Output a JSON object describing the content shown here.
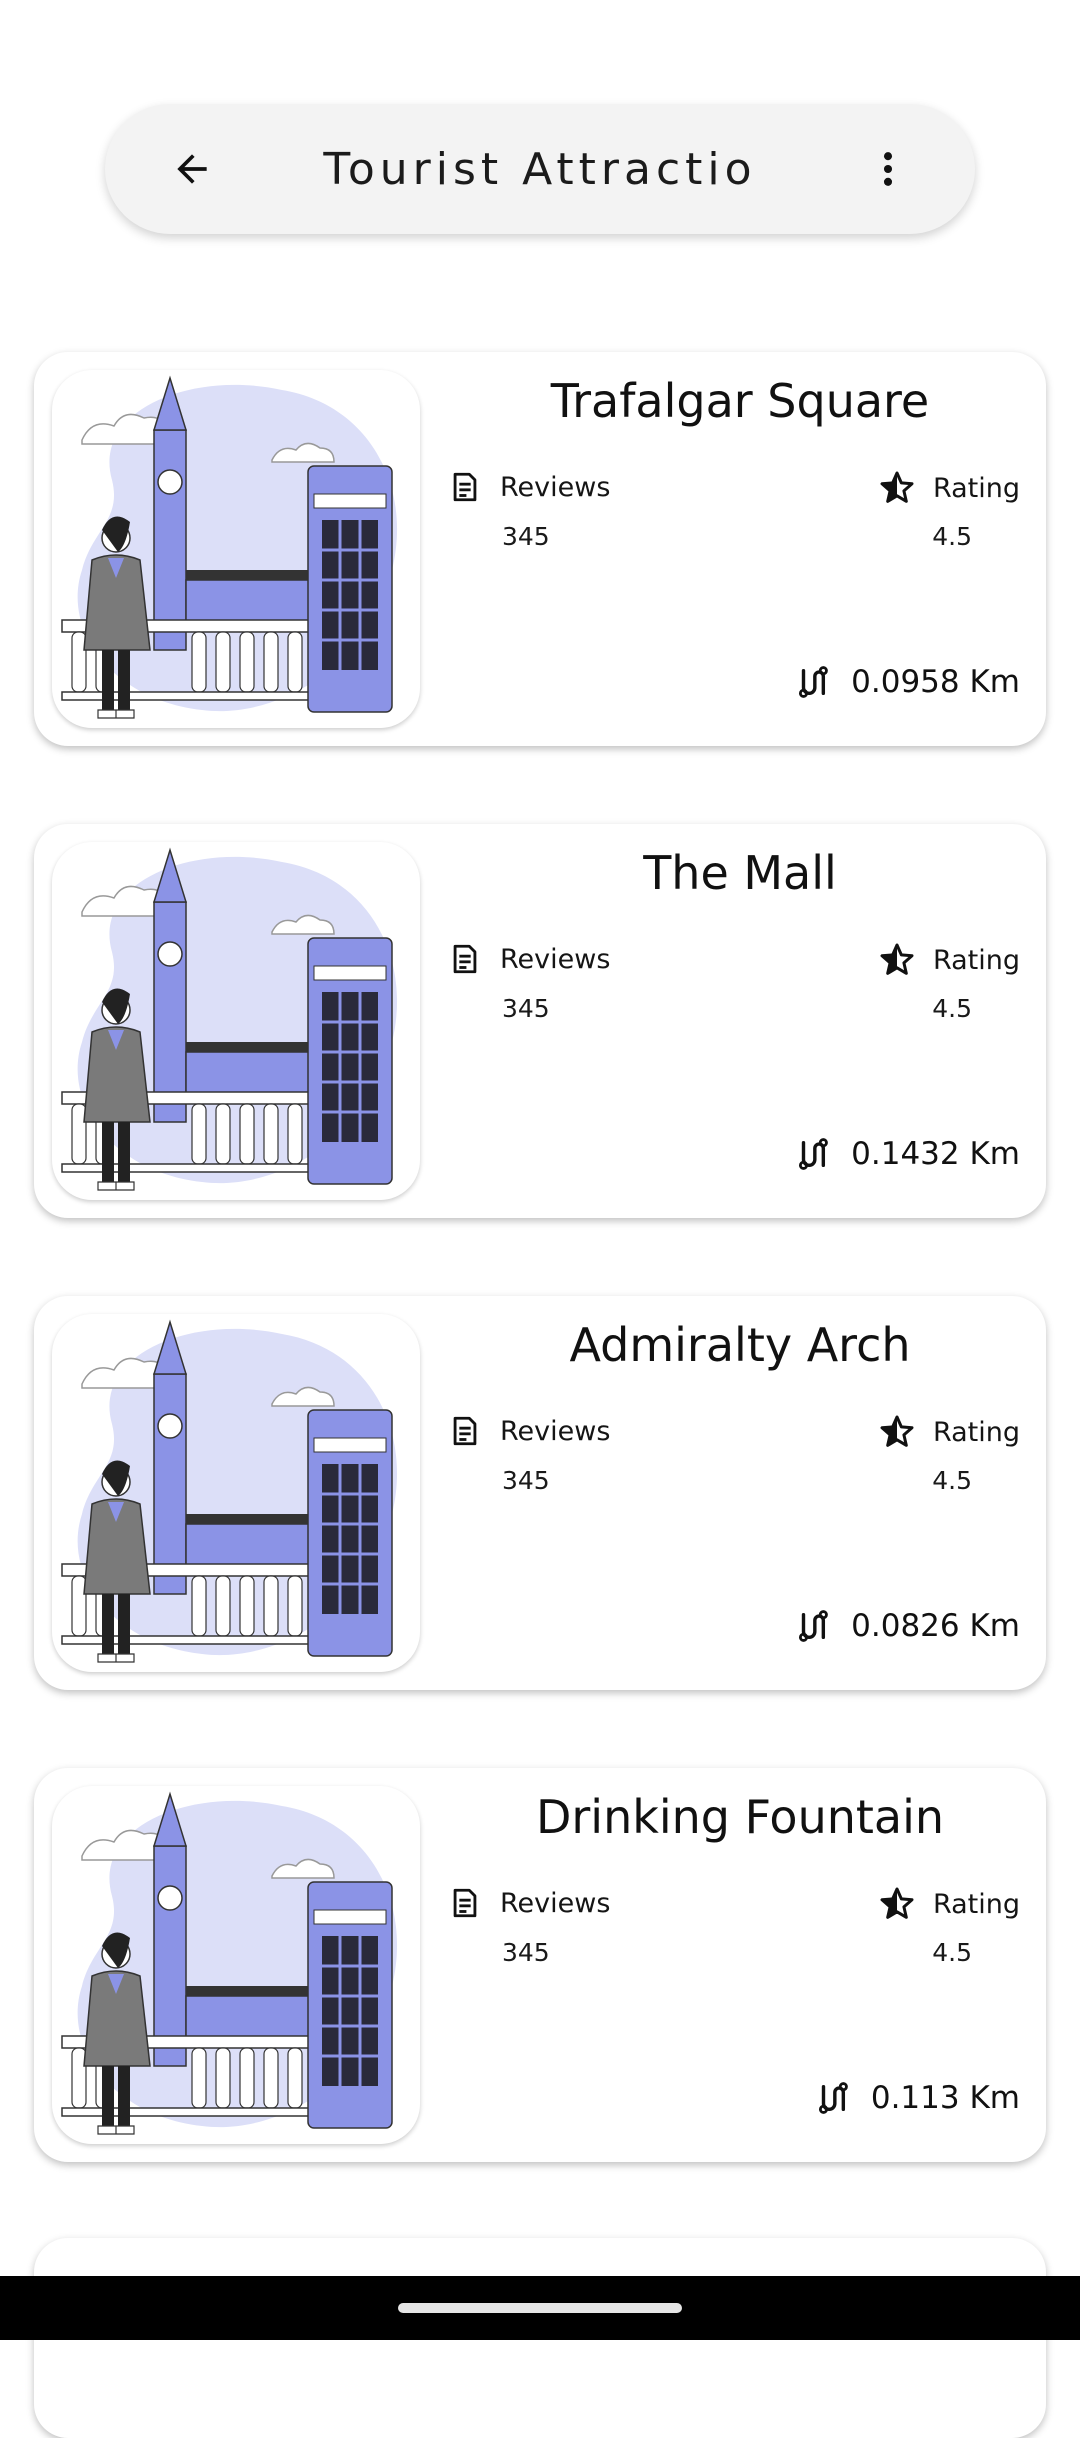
{
  "header": {
    "title": "Tourist Attractio"
  },
  "labels": {
    "reviews": "Reviews",
    "rating": "Rating"
  },
  "attractions": [
    {
      "name": "Trafalgar Square",
      "reviews": "345",
      "rating": "4.5",
      "distance": "0.0958 Km"
    },
    {
      "name": "The Mall",
      "reviews": "345",
      "rating": "4.5",
      "distance": "0.1432 Km"
    },
    {
      "name": "Admiralty Arch",
      "reviews": "345",
      "rating": "4.5",
      "distance": "0.0826 Km"
    },
    {
      "name": "Drinking Fountain",
      "reviews": "345",
      "rating": "4.5",
      "distance": "0.113 Km"
    }
  ],
  "colors": {
    "accent": "#8b93e6",
    "blob": "#dcdff8",
    "card": "#ffffff",
    "topbar": "#f3f3f3"
  },
  "icons": {
    "back": "arrow-left-icon",
    "menu": "more-vertical-icon",
    "reviews": "document-icon",
    "rating": "star-half-icon",
    "distance": "route-icon"
  }
}
